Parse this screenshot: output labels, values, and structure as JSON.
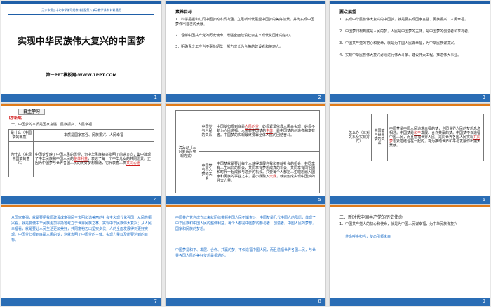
{
  "slide1": {
    "banner": "天水市第三十七中学编写组教材适配第八单元教学课件 材料通用",
    "title": "实现中华民族伟大复兴的中国梦",
    "site": "第一PPT模板网-WWW.1PPT.COM",
    "num": "1"
  },
  "slide2": {
    "heading": "素养目标",
    "lines": [
      "1．科学把握和认同中国梦的本质内涵，立足新时代展望中国梦的美好前景，并为实现中国梦作出自己的贡献。",
      "2．理解中国共产党的历史使命，增强全面建设社会主义现代化国家的信心。",
      "3．明确青少年应当不辜负韶华，努力成长为合格的建设者和接班人。"
    ],
    "num": "2"
  },
  "slide3": {
    "heading": "要点展望",
    "lines": [
      "1．实现中华民族伟大复兴的中国梦，就是要实现国家富强、民族振兴、人民幸福。",
      "2．中国梦归根到底是人民的梦，人民是中国梦的主体，是中国梦的创造者和享有者。",
      "3．中国共产党的初心和使命，就是为中国人民谋幸福，为中华民族谋复兴。",
      "4．实现中华民族伟大复兴必须进行伟大斗争、建设伟大工程、推进伟大事业。"
    ],
    "num": "3"
  },
  "slide4": {
    "tab": "自主学习",
    "section": "【学新知】",
    "q1": "一、中国梦的本质是国家富强、民族振兴、人民幸福",
    "row1_label": "是什么（中国梦的本质）",
    "row1_text": "本质是国家富强、民族振兴、人民幸福",
    "row2_label": "为什么（实现中国梦的意义）",
    "row2_pre": "中国梦反映了中国人民的愿望，为中华民族复兴指明了前进方向，集中体现了中华民族和中国人民的",
    "row2_mark": "整体利益",
    "row2_post": "，表达了每一个中华儿女的共同愿景。正因为中国梦与世界各国人民的美好梦想相通，它代表着人类",
    "row2_mark2": "共同心愿",
    "num": "4"
  },
  "slide5": {
    "left_label": "怎么办（三对关系及实现方式）",
    "r1_label": "中国梦与人民的关系",
    "r1_pre": "中国梦归根到底是",
    "r1_mark": "人民的梦",
    "r1_mid": "，必须紧紧依靠人民来实现，必须不断为人民造福。人民是中国梦的",
    "r1_mark2": "主体",
    "r1_post": "，是中国梦的创造者和享有者。中国梦的实现最终要靠全体人民的团结奋斗。",
    "r2_label": "中国梦与个人梦的关系",
    "r2_pre": "中国梦就是要让每个人获得发展自我和奉献社会的机会，共同享有人生出彩的机会，共同享有梦想成真的机会，共同享有同祖国和时代一起成长与进步的机会。只要每个人都把人生理想融入国家和民族的事业之中，把小我融入",
    "r2_mark": "大我",
    "r2_post": "，就会形成实现中国梦的强大力量。",
    "num": "5"
  },
  "slide6": {
    "left_label": "怎么办（三对关系及实现方式）",
    "mid_label": "中国梦与世界梦的关系",
    "text_pre": "中国梦是中国人民追求幸福的梦，也同世界人民的梦想息息相通。中国梦是",
    "text_mark": "和平",
    "text_mid": "发展、合作共赢的梦。中国梦不仅造福中国人民，而且造福世界人民，是同世界各国人民实现",
    "text_mark2": "共同梦",
    "text_post": "想紧密结合在一起的，将为推动世界和平与发展作出更大贡献。",
    "num": "6"
  },
  "slide7": {
    "para": "从国家富强，就是要把我国建设成富强民主文明和谐美丽的社会主义现代化强国；从民族振兴看，就是要使中华民族更加昂扬地屹立于世界民族之林，实现中华民族伟大复兴；从人民幸福看，就是要让人民生活更加美好，共同富裕迈出坚实步伐，人的全面发展得到更好实现。中国梦归根到底是人民的梦，这就表明了中国梦的主体、实现力量以及所要达到的目标。",
    "num": "7"
  },
  "slide8": {
    "para1": "中国共产党自成立以来就团结带领中国人民不懈奋斗，中国梦是几代中国人的夙愿，体现了中华民族和中国人民的整体利益，每个人都是中国梦的参与者、创造者。中国人民的梦想，国家和民族的梦想。",
    "para2": "中国梦是和平、发展、合作、共赢的梦，不仅造福中国人民，而且造福世界各国人民，与世界各国人民的美好梦想是相通的。",
    "num": "8"
  },
  "slide9": {
    "heading": "二、新时代中国共产党的历史使命",
    "line1": "1．中国共产党人的初心和使命，就是为中国人民谋幸福，为中华民族谋复兴",
    "line2": "使命呼唤担当，使命引领未来",
    "num": "9"
  }
}
